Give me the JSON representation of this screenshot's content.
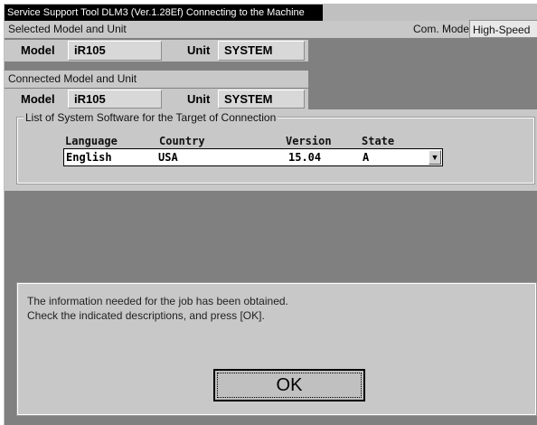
{
  "window": {
    "title": "Service Support Tool DLM3 (Ver.1.28Ef) Connecting to the Machine"
  },
  "selected": {
    "section_label": "Selected Model and Unit",
    "model_label": "Model",
    "model_value": "iR105",
    "unit_label": "Unit",
    "unit_value": "SYSTEM",
    "com_mode_label": "Com. Mode",
    "com_mode_value": "High-Speed"
  },
  "connected": {
    "section_label": "Connected Model and Unit",
    "model_label": "Model",
    "model_value": "iR105",
    "unit_label": "Unit",
    "unit_value": "SYSTEM"
  },
  "software_list": {
    "group_label": "List of System Software for the Target of Connection",
    "headers": {
      "language": "Language",
      "country": "Country",
      "version": "Version",
      "state": "State"
    },
    "selected": {
      "language": "English",
      "country": "USA",
      "version": "15.04",
      "state": "A"
    }
  },
  "message": {
    "line1": "The information needed for the job has been obtained.",
    "line2": "Check the indicated descriptions, and press [OK].",
    "ok_label": "OK"
  },
  "colors": {
    "window_bg": "#808080",
    "panel_bg": "#c8c8c8",
    "titlebar_bg": "#000000"
  }
}
